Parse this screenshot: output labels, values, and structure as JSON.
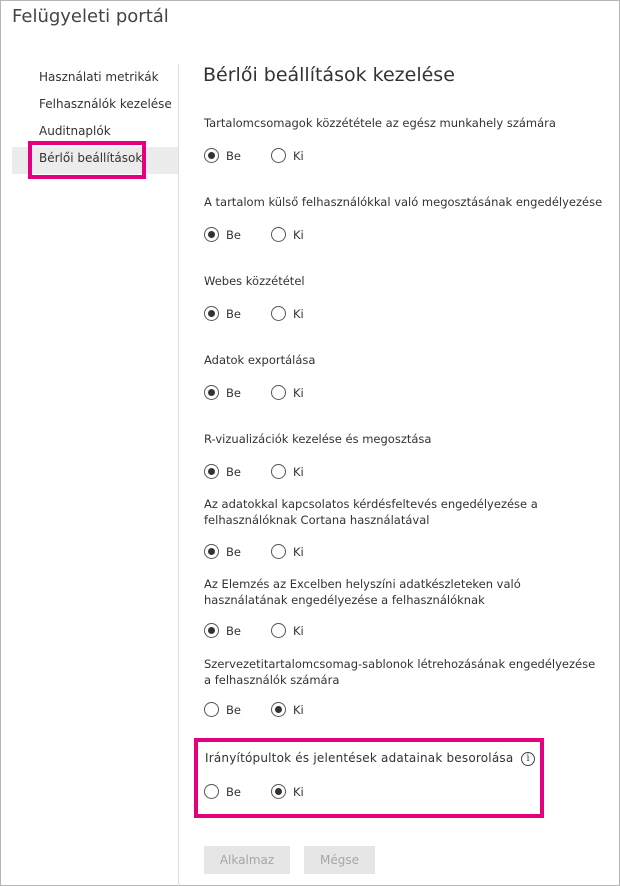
{
  "portal": {
    "title": "Felügyeleti portál"
  },
  "sidebar": {
    "items": [
      {
        "label": "Használati metrikák"
      },
      {
        "label": "Felhasználók kezelése"
      },
      {
        "label": "Auditnaplók"
      },
      {
        "label": "Bérlői beállítások",
        "active": true
      }
    ]
  },
  "main": {
    "title": "Bérlői beállítások kezelése",
    "options": {
      "on": "Be",
      "off": "Ki"
    },
    "settings": [
      {
        "label": "Tartalomcsomagok közzététele az egész munkahely számára",
        "value": "Be"
      },
      {
        "label": "A tartalom külső felhasználókkal való megosztásának engedélyezése",
        "value": "Be"
      },
      {
        "label": "Webes közzététel",
        "value": "Be"
      },
      {
        "label": "Adatok exportálása",
        "value": "Be"
      },
      {
        "label": "R-vizualizációk kezelése és megosztása",
        "value": "Be"
      },
      {
        "label": "Az adatokkal kapcsolatos kérdésfeltevés engedélyezése a felhasználóknak Cortana használatával",
        "value": "Be"
      },
      {
        "label": "Az Elemzés az Excelben helyszíni adatkészleteken való használatának engedélyezése a felhasználóknak",
        "value": "Be"
      },
      {
        "label": "Szervezetitartalomcsomag-sablonok létrehozásának engedélyezése a felhasználók számára",
        "value": "Ki"
      },
      {
        "label": "Irányítópultok és jelentések adatainak besorolása",
        "value": "Ki"
      }
    ],
    "buttons": {
      "apply": "Alkalmaz",
      "cancel": "Mégse"
    }
  },
  "colors": {
    "highlight": "#e6007e",
    "active_bg": "#ececec",
    "button_bg": "#e6e6e6"
  },
  "icons": {
    "info": "info-icon"
  }
}
